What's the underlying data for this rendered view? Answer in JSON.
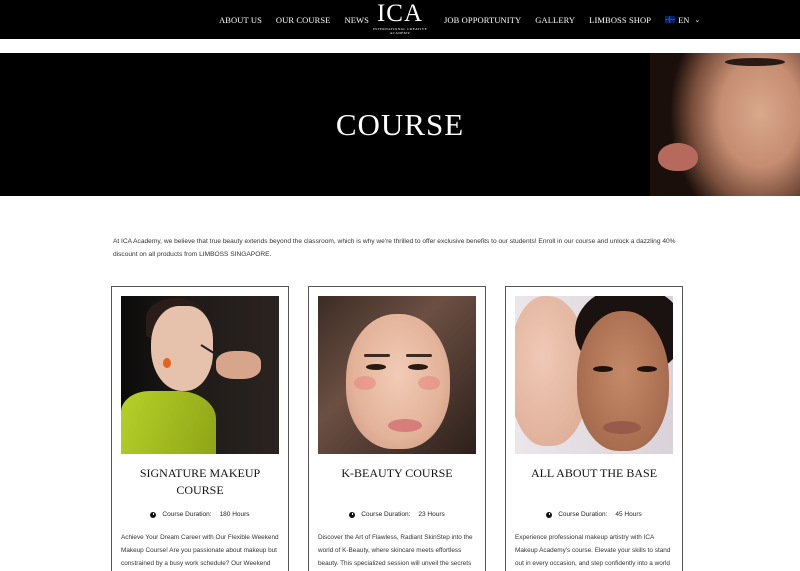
{
  "header": {
    "nav_left": [
      "ABOUT US",
      "OUR COURSE",
      "NEWS"
    ],
    "logo": {
      "mark": "ICA",
      "sub": "INTERNATIONAL CREATIVE ACADEMY"
    },
    "nav_right": [
      "JOB OPPORTUNITY",
      "GALLERY",
      "LIMBOSS SHOP"
    ],
    "language": "EN"
  },
  "hero": {
    "title": "COURSE"
  },
  "intro": "At ICA Academy, we believe that true beauty extends beyond the classroom, which is why we're thrilled to offer exclusive benefits to our students! Enroll in our course and unlock a dazzling 40% discount on all products from LIMBOSS SINGAPORE.",
  "courses": [
    {
      "title": "SIGNATURE MAKEUP COURSE",
      "duration_label": "Course Duration:",
      "duration": "180 Hours",
      "description": "Achieve Your Dream Career with Our Flexible Weekend Makeup Course! Are you passionate about makeup but constrained by a busy work schedule? Our Weekend"
    },
    {
      "title": "K-BEAUTY COURSE",
      "duration_label": "Course Duration:",
      "duration": "23 Hours",
      "description": "Discover the Art of Flawless, Radiant SkinStep into the world of K-Beauty, where skincare meets effortless beauty. This specialized session will unveil the secrets"
    },
    {
      "title": "ALL ABOUT THE BASE",
      "duration_label": "Course Duration:",
      "duration": "45 Hours",
      "description": "Experience professional makeup artistry with ICA Makeup Academy's course. Elevate your skills to stand out in every occasion, and step confidently into a world"
    }
  ],
  "icons": {
    "clock": "clock-icon",
    "flag": "uk-flag-icon",
    "chevron": "chevron-down-icon"
  }
}
